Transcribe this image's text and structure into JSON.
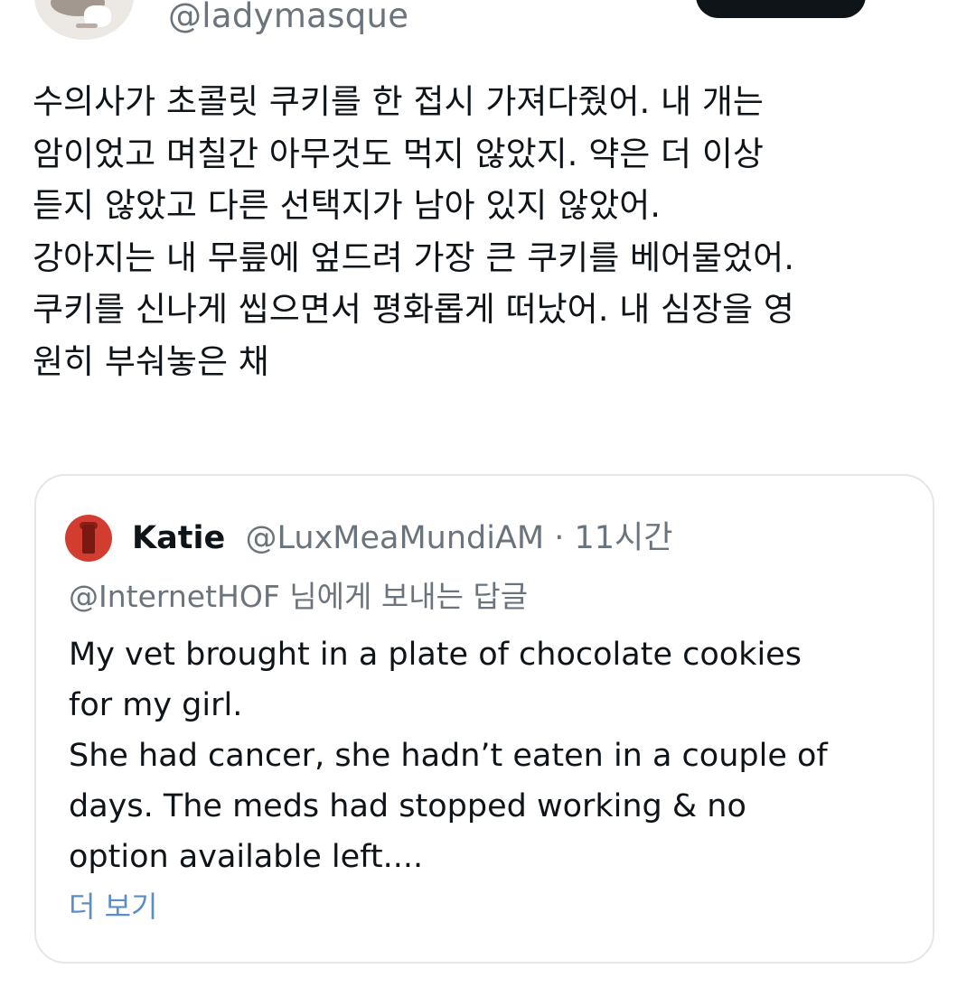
{
  "tweet": {
    "handle": "@ladymasque",
    "lines": [
      "수의사가 초콜릿 쿠키를 한 접시 가져다줬어. 내 개는",
      "암이었고 며칠간 아무것도 먹지 않았지. 약은 더 이상",
      "듣지 않았고 다른 선택지가 남아 있지 않았어.",
      "강아지는 내 무릎에 엎드려 가장 큰 쿠키를 베어물었어.",
      "쿠키를 신나게 씹으면서 평화롭게 떠났어. 내 심장을 영",
      "원히 부숴놓은 채"
    ]
  },
  "quote": {
    "name": "Katie",
    "handle": "@LuxMeaMundiAM",
    "separator": " · ",
    "time": "11시간",
    "reply_to": "@InternetHOF 님에게 보내는 답글",
    "lines": [
      "My vet brought in a plate of chocolate cookies",
      "for my girl.",
      "She had cancer, she hadn’t eaten in a couple of",
      "days. The meds had stopped working & no",
      "option available left...."
    ],
    "show_more": "더 보기"
  },
  "colors": {
    "text": "#0f1419",
    "secondary": "#6b747d",
    "link": "#5b8fc4",
    "border": "#e3e7ea"
  },
  "icons": [
    "profile-avatar",
    "quote-avatar"
  ]
}
